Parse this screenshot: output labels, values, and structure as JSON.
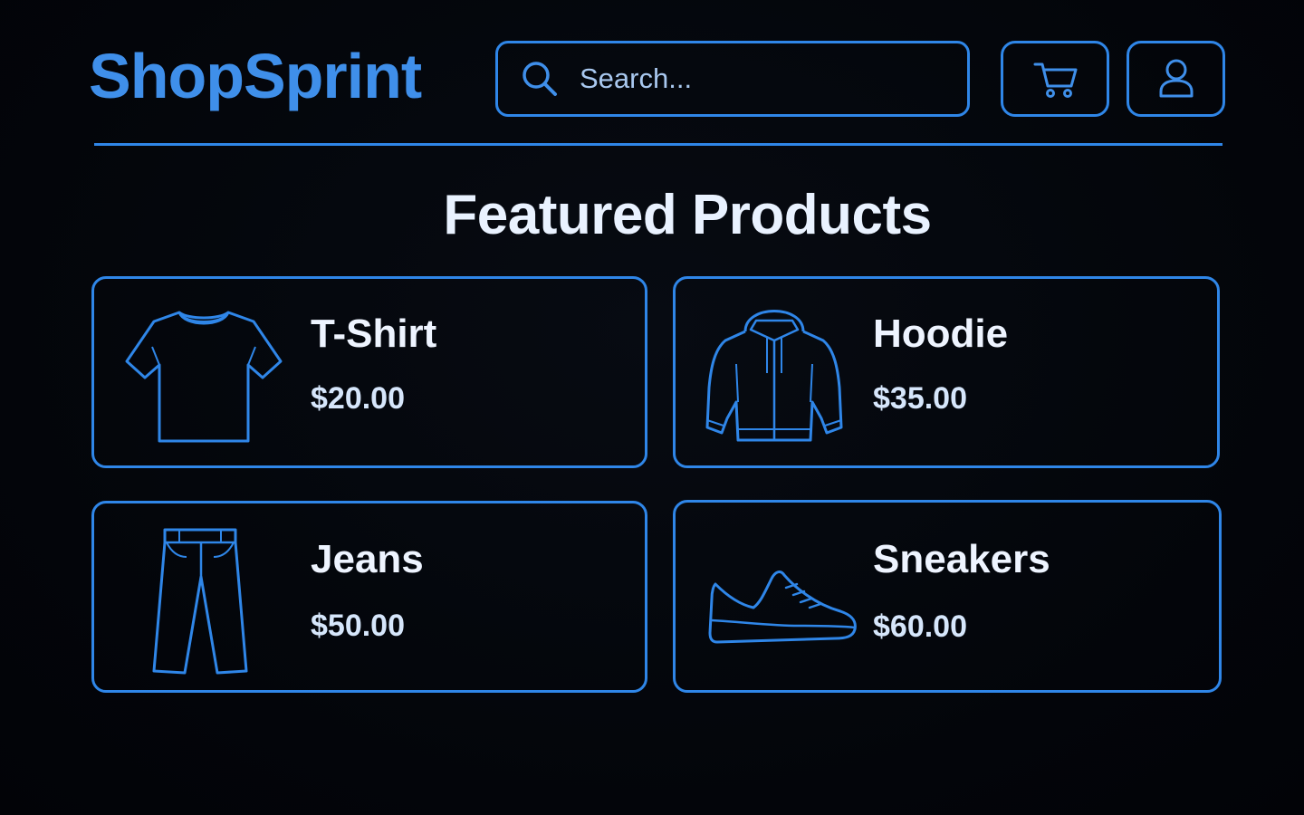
{
  "header": {
    "brand": "ShopSprint",
    "search": {
      "placeholder": "Search..."
    },
    "cart_icon": "shopping-cart-icon",
    "account_icon": "user-icon"
  },
  "main": {
    "section_title": "Featured Products",
    "products": [
      {
        "name": "T-Shirt",
        "price": "$20.00",
        "icon": "t-shirt-icon"
      },
      {
        "name": "Hoodie",
        "price": "$35.00",
        "icon": "hoodie-icon"
      },
      {
        "name": "Jeans",
        "price": "$50.00",
        "icon": "jeans-icon"
      },
      {
        "name": "Sneakers",
        "price": "$60.00",
        "icon": "sneaker-icon"
      }
    ]
  },
  "theme": {
    "background": "#03050a",
    "accent": "#2f86e8",
    "brand": "#3f8fea",
    "text": "#e9f2ff"
  }
}
